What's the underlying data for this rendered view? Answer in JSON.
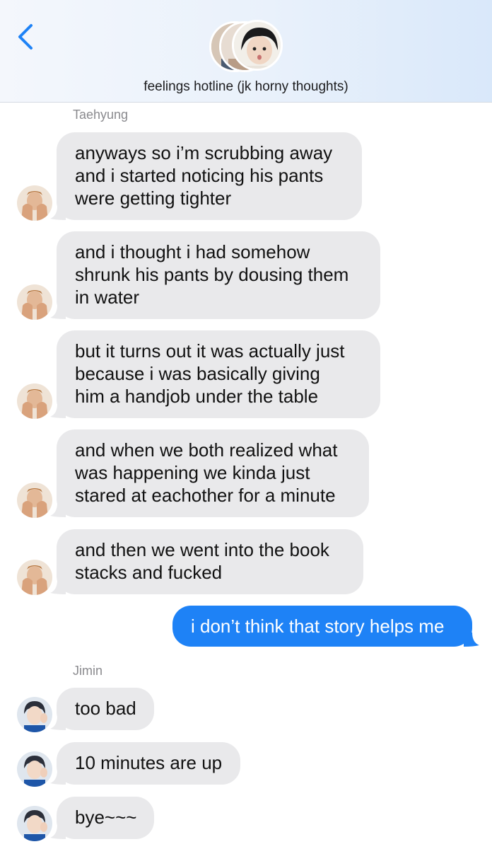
{
  "header": {
    "back_icon": "chevron-left-icon",
    "group_title": "feelings hotline (jk horny thoughts)",
    "accent_color": "#1e82f6"
  },
  "messages": [
    {
      "sender": "Taehyung",
      "direction": "received",
      "lines": [
        "anyways so i’m scrubbing away",
        "and i started noticing his pants",
        "were getting tighter"
      ]
    },
    {
      "sender": "Taehyung",
      "direction": "received",
      "lines": [
        "and i thought i had somehow",
        "shrunk his pants by dousing them",
        "in water"
      ]
    },
    {
      "sender": "Taehyung",
      "direction": "received",
      "lines": [
        "but it turns out it was actually just",
        "because i was basically giving",
        "him a handjob under the table"
      ]
    },
    {
      "sender": "Taehyung",
      "direction": "received",
      "lines": [
        "and when we both realized what",
        "was happening we kinda just",
        "stared at eachother for a minute"
      ]
    },
    {
      "sender": "Taehyung",
      "direction": "received",
      "lines": [
        "and then we went into the book",
        "stacks and fucked"
      ]
    },
    {
      "sender": "me",
      "direction": "sent",
      "lines": [
        "i don’t think that story helps me"
      ]
    },
    {
      "sender": "Jimin",
      "direction": "received",
      "lines": [
        "too bad"
      ]
    },
    {
      "sender": "Jimin",
      "direction": "received",
      "lines": [
        "10 minutes are up"
      ]
    },
    {
      "sender": "Jimin",
      "direction": "received",
      "lines": [
        "bye~~~"
      ]
    }
  ],
  "senders": {
    "taehyung": "Taehyung",
    "jimin": "Jimin"
  }
}
